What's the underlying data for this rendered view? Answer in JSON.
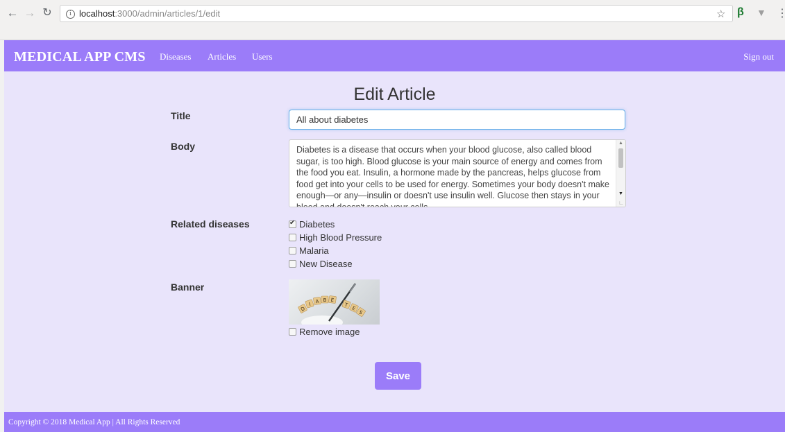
{
  "browser": {
    "url_host": "localhost",
    "url_path": ":3000/admin/articles/1/edit",
    "icons": [
      "back-icon",
      "forward-icon",
      "reload-icon",
      "info-icon",
      "star-icon",
      "extension-icon",
      "extension-icon",
      "menu-icon"
    ]
  },
  "topnav": {
    "brand": "MEDICAL APP CMS",
    "links": [
      "Diseases",
      "Articles",
      "Users"
    ],
    "sign_out": "Sign out",
    "color": "#9b7cf9"
  },
  "form": {
    "heading": "Edit Article",
    "title_label": "Title",
    "title_value": "All about diabetes",
    "body_label": "Body",
    "body_value": "Diabetes is a disease that occurs when your blood glucose, also called blood sugar, is too high. Blood glucose is your main source of energy and comes from the food you eat. Insulin, a hormone made by the pancreas, helps glucose from food get into your cells to be used for energy. Sometimes your body doesn't make enough—or any—insulin or doesn't use insulin well. Glucose then stays in your blood and doesn't reach your cells.",
    "related_label": "Related diseases",
    "diseases": [
      {
        "label": "Diabetes",
        "checked": true
      },
      {
        "label": "High Blood Pressure",
        "checked": false
      },
      {
        "label": "Malaria",
        "checked": false
      },
      {
        "label": "New Disease",
        "checked": false
      }
    ],
    "banner_label": "Banner",
    "banner_tiles": [
      "D",
      "I",
      "A",
      "B",
      "E",
      "T",
      "E",
      "S"
    ],
    "remove_image_label": "Remove image",
    "remove_image_checked": false,
    "save_label": "Save"
  },
  "footer": {
    "text": "Copyright © 2018 Medical App | All Rights Reserved"
  },
  "colors": {
    "accent": "#9b7cf9",
    "page_bg": "#e9e4fb",
    "focus_border": "#66afe9"
  }
}
